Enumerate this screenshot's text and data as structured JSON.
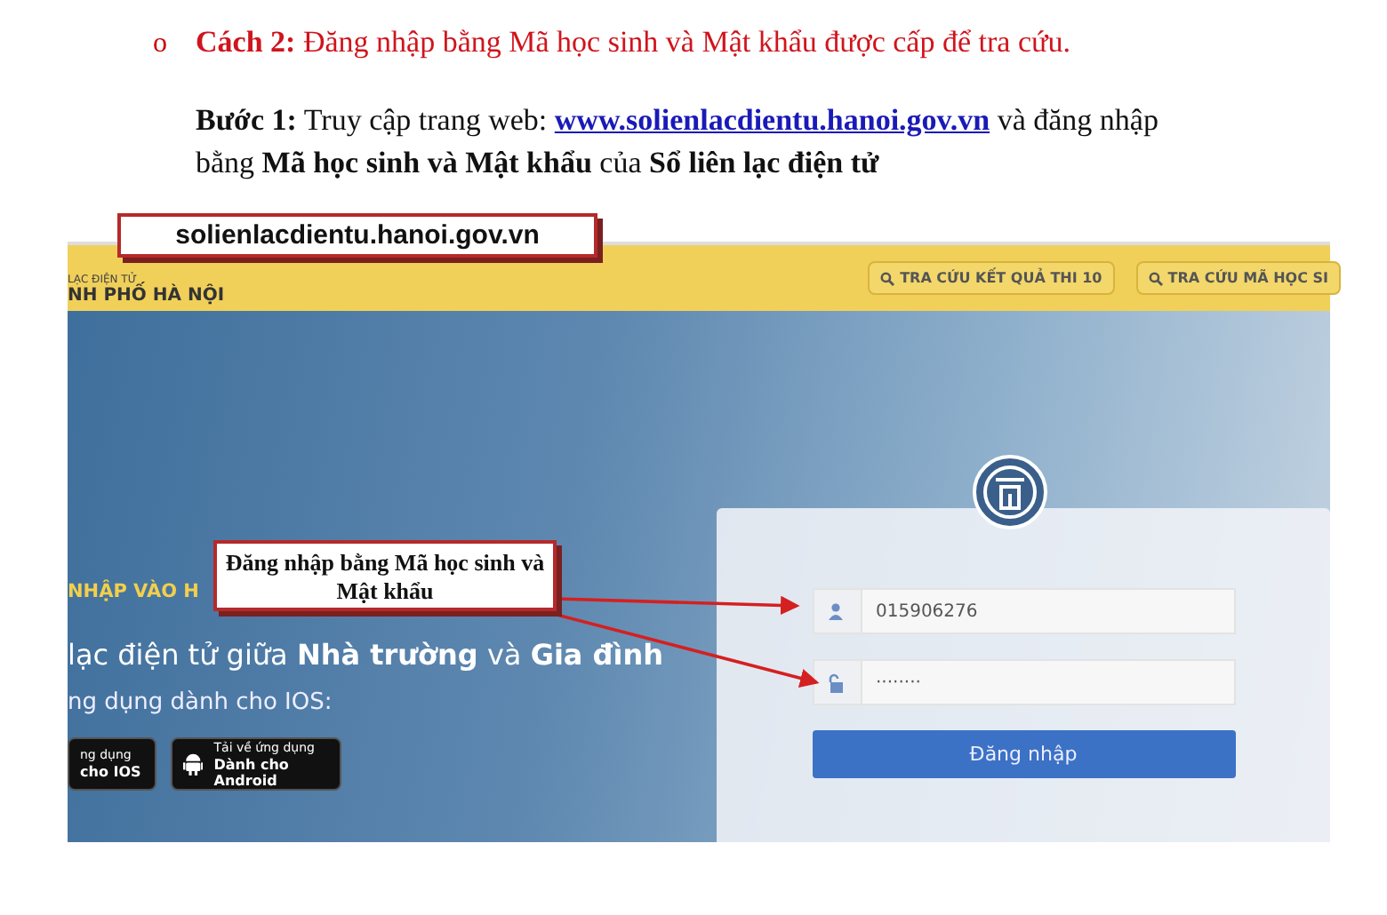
{
  "document": {
    "bullet": "o",
    "heading": "**Cách 2:** Đăng nhập bằng Mã học sinh và Mật khẩu được cấp để tra cứu.",
    "step": {
      "before": "**Bước 1:** Truy cập trang web: ",
      "link": "www.solienlacdientu.hanoi.gov.vn",
      "after": " và đăng nhập bằng **Mã học sinh và Mật khẩu** của **Sổ liên lạc điện tử**"
    }
  },
  "screenshot": {
    "header": {
      "subtitle": "LẠC ĐIỆN TỬ",
      "title": "NH PHỐ HÀ NỘI",
      "links": [
        "TRA CỨU KẾT QUẢ THI 10",
        "TRA CỨU MÃ HỌC SI"
      ]
    },
    "hero": {
      "kicker": "NHẬP VÀO H",
      "headline": "lạc điện tử giữa **Nhà trường** và **Gia đình**",
      "subline": "ng dụng dành cho IOS:",
      "apps": [
        {
          "kind": "ios",
          "line1": "ng dụng",
          "line2": "cho IOS"
        },
        {
          "kind": "android",
          "line1": "Tải về ứng dụng",
          "line2": "Dành cho Android"
        }
      ]
    },
    "login": {
      "fields": [
        {
          "kind": "user",
          "value": "015906276"
        },
        {
          "kind": "password",
          "value": "········"
        }
      ],
      "button": "Đăng nhập"
    },
    "callouts": [
      {
        "kind": "url",
        "text": "solienlacdientu.hanoi.gov.vn"
      },
      {
        "kind": "note",
        "text": "Đăng nhập bằng Mã học sinh và Mật khẩu"
      }
    ]
  }
}
